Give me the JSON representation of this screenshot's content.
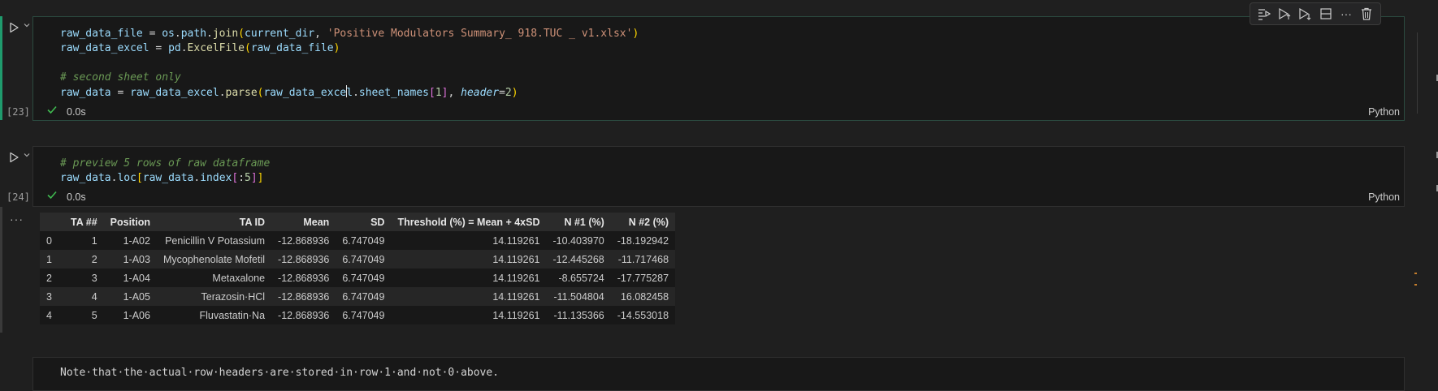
{
  "toolbar": {
    "icons": [
      "run-by-line-icon",
      "execute-above-icon",
      "execute-below-icon",
      "split-cell-icon",
      "more-icon",
      "delete-icon"
    ],
    "more_label": "···"
  },
  "cell1": {
    "execution_count": "[23]",
    "status_time": "0.0s",
    "language": "Python",
    "lines": [
      "raw_data_file = os.path.join(current_dir, 'Positive Modulators Summary_ 918.TUC _ v1.xlsx')",
      "raw_data_excel = pd.ExcelFile(raw_data_file)",
      "",
      "# second sheet only",
      "raw_data = raw_data_excel.parse(raw_data_excel.sheet_names[1], header=2)"
    ]
  },
  "cell2": {
    "execution_count": "[24]",
    "status_time": "0.0s",
    "language": "Python",
    "lines": [
      "# preview 5 rows of raw dataframe",
      "raw_data.loc[raw_data.index[:5]]"
    ]
  },
  "output": {
    "more_label": "···",
    "table": {
      "columns": [
        "",
        "TA ##",
        "Position",
        "TA ID",
        "Mean",
        "SD",
        "Threshold (%) = Mean + 4xSD",
        "N #1 (%)",
        "N #2 (%)"
      ],
      "rows": [
        [
          "0",
          "1",
          "1-A02",
          "Penicillin V Potassium",
          "-12.868936",
          "6.747049",
          "14.119261",
          "-10.403970",
          "-18.192942"
        ],
        [
          "1",
          "2",
          "1-A03",
          "Mycophenolate Mofetil",
          "-12.868936",
          "6.747049",
          "14.119261",
          "-12.445268",
          "-11.717468"
        ],
        [
          "2",
          "3",
          "1-A04",
          "Metaxalone",
          "-12.868936",
          "6.747049",
          "14.119261",
          "-8.655724",
          "-17.775287"
        ],
        [
          "3",
          "4",
          "1-A05",
          "Terazosin·HCl",
          "-12.868936",
          "6.747049",
          "14.119261",
          "-11.504804",
          "16.082458"
        ],
        [
          "4",
          "5",
          "1-A06",
          "Fluvastatin·Na",
          "-12.868936",
          "6.747049",
          "14.119261",
          "-11.135366",
          "-14.553018"
        ]
      ]
    }
  },
  "markdown": {
    "text": "Note·that·the·actual·row·headers·are·stored·in·row·1·and·not·0·above."
  },
  "colors": {
    "focus_accent": "#1f9b6d",
    "success": "#3fb950",
    "background": "#1f1f1f"
  }
}
